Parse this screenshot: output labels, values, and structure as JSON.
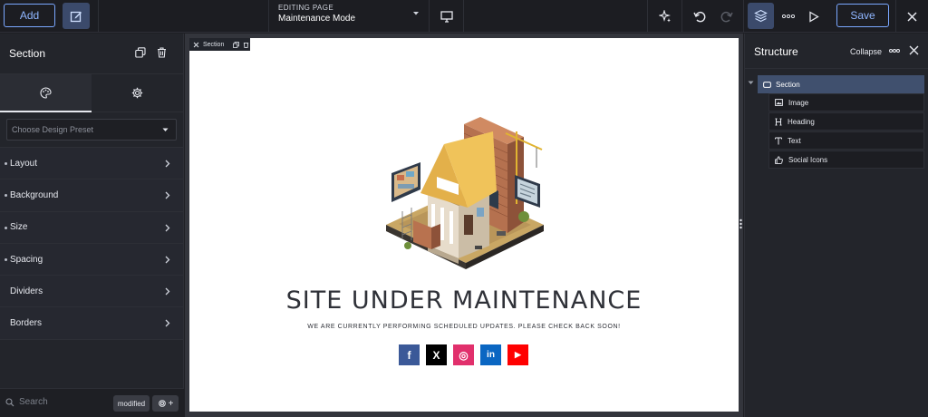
{
  "topbar": {
    "add_label": "Add",
    "editing_label": "EDITING PAGE",
    "editing_value": "Maintenance Mode",
    "save_label": "Save"
  },
  "left_panel": {
    "title": "Section",
    "preset_placeholder": "Choose Design Preset",
    "sections": [
      {
        "label": "Layout",
        "modified": true
      },
      {
        "label": "Background",
        "modified": true
      },
      {
        "label": "Size",
        "modified": true
      },
      {
        "label": "Spacing",
        "modified": true
      },
      {
        "label": "Dividers",
        "modified": false
      },
      {
        "label": "Borders",
        "modified": false
      }
    ],
    "search_placeholder": "Search",
    "filter_badge": "modified",
    "add_symbol": "+"
  },
  "canvas": {
    "section_tag": "Section",
    "heading": "SITE UNDER MAINTENANCE",
    "subtext": "WE ARE CURRENTLY PERFORMING SCHEDULED UPDATES. PLEASE CHECK BACK SOON!",
    "socials": [
      {
        "name": "facebook",
        "glyph": "f",
        "color": "#3b5998"
      },
      {
        "name": "x",
        "glyph": "X",
        "color": "#000000"
      },
      {
        "name": "instagram",
        "glyph": "◎",
        "color": "#e1306c"
      },
      {
        "name": "linkedin",
        "glyph": "in",
        "color": "#0a66c2"
      },
      {
        "name": "youtube",
        "glyph": "▶",
        "color": "#ff0000"
      }
    ]
  },
  "structure": {
    "title": "Structure",
    "collapse_label": "Collapse",
    "root": "Section",
    "children": [
      "Image",
      "Heading",
      "Text",
      "Social Icons"
    ]
  },
  "colors": {
    "accent": "#7aa7ff",
    "panel": "#23252b",
    "selected_row": "#40506e"
  }
}
